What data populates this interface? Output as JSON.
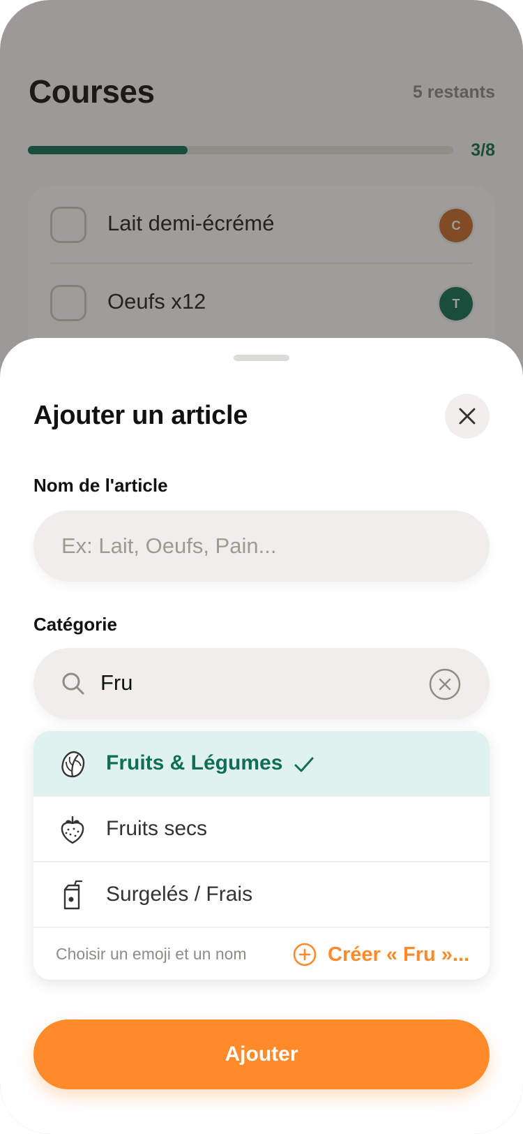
{
  "background_screen": {
    "title": "Courses",
    "remaining": "5 restants",
    "progress": {
      "label": "3/8",
      "fraction": 0.375,
      "color": "#0f6e55"
    },
    "items": [
      {
        "label": "Lait demi-écrémé",
        "assignee_initial": "C",
        "assignee_color": "#c96a2a"
      },
      {
        "label": "Oeufs x12",
        "assignee_initial": "T",
        "assignee_color": "#0f6e55"
      }
    ]
  },
  "sheet": {
    "title": "Ajouter un article",
    "close_icon": "close-icon",
    "name_field": {
      "label": "Nom de l'article",
      "value": "",
      "placeholder": "Ex: Lait, Oeufs, Pain..."
    },
    "category_field": {
      "label": "Catégorie",
      "search_value": "Fru",
      "search_icon": "search-icon",
      "clear_icon": "clear-circle-icon"
    },
    "options": [
      {
        "label": "Fruits & Légumes",
        "icon": "lettuce-icon",
        "selected": true
      },
      {
        "label": "Fruits secs",
        "icon": "strawberry-icon",
        "selected": false
      },
      {
        "label": "Surgelés / Frais",
        "icon": "juice-box-icon",
        "selected": false
      }
    ],
    "create": {
      "hint": "Choisir un emoji et un nom",
      "label": "Créer « Fru »...",
      "icon": "plus-circle-icon"
    },
    "submit_label": "Ajouter"
  },
  "colors": {
    "accent": "#ff8a2a",
    "primary": "#0f6e55",
    "selected_bg": "#dff2ee"
  }
}
